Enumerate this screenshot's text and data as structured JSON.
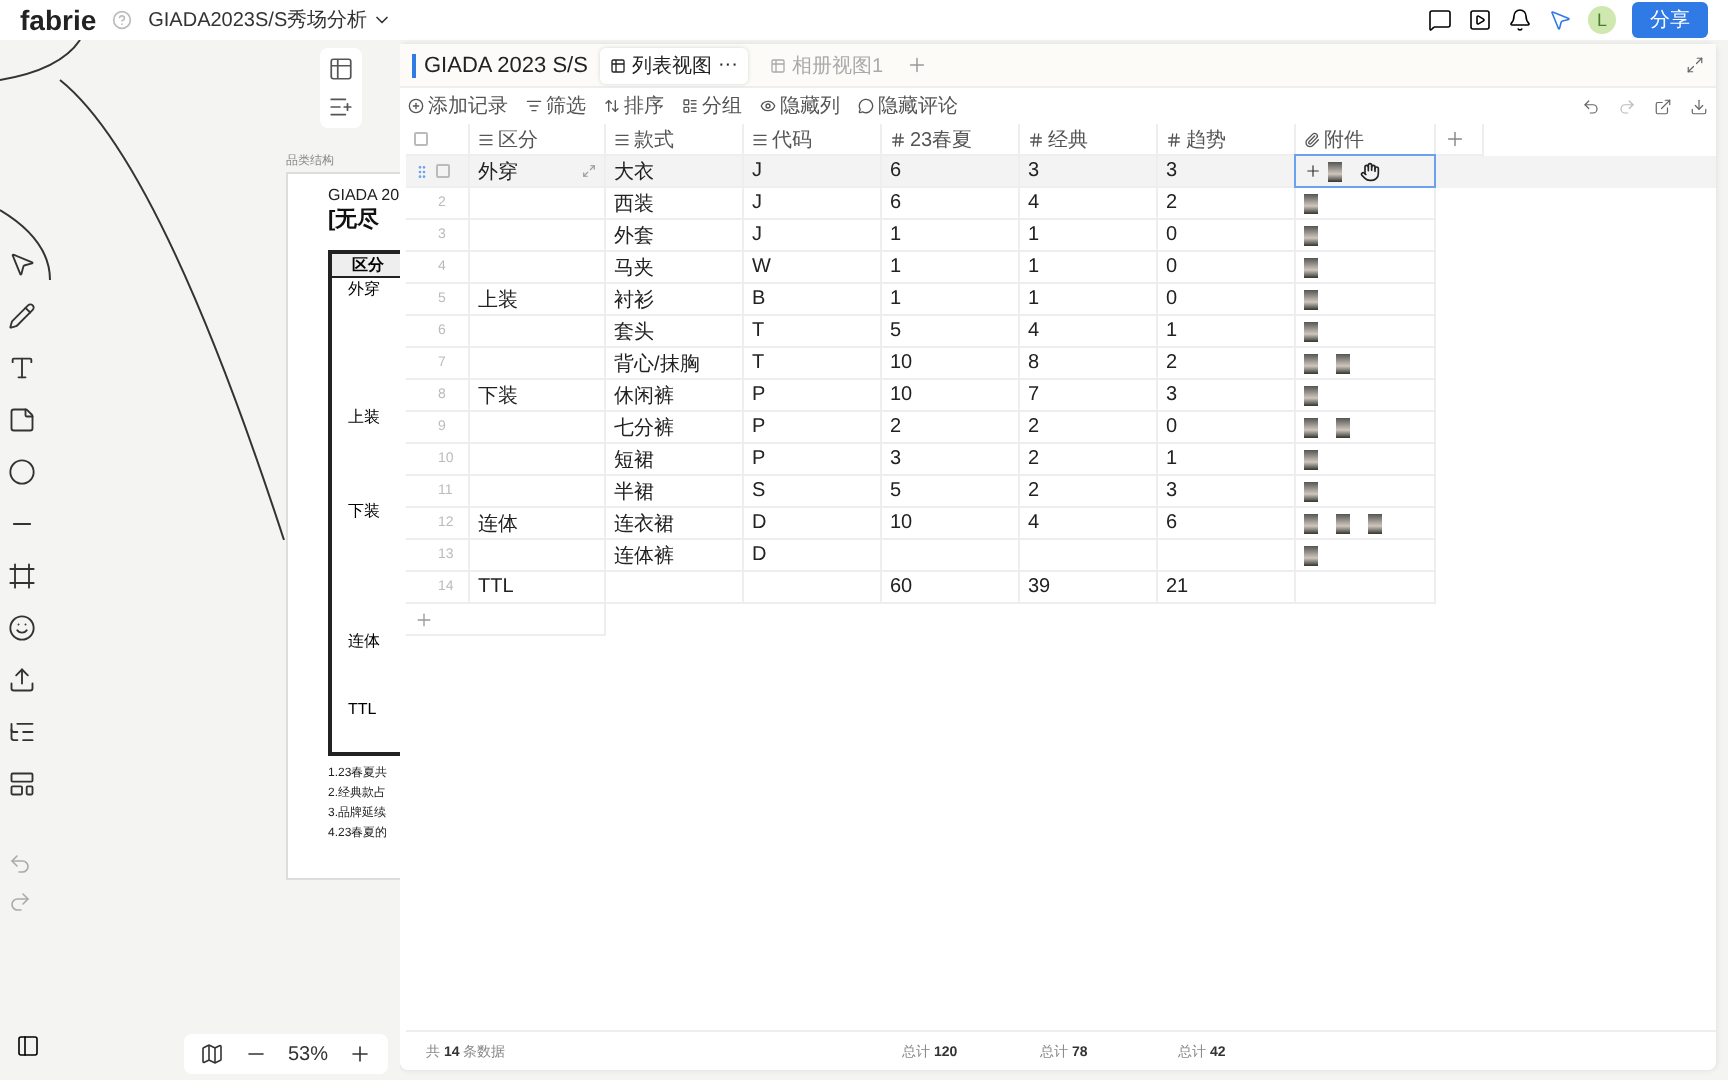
{
  "app": {
    "logo": "fabrie",
    "doc_title": "GIADA2023S/S秀场分析",
    "share": "分享",
    "avatar": "L"
  },
  "canvas": {
    "zoom": "53%",
    "board": {
      "label": "品类结构",
      "title": "GIADA 20",
      "subtitle": "[无尽",
      "table_header": "区分",
      "groups": [
        "外穿",
        "上装",
        "下装",
        "连体",
        "TTL"
      ],
      "notes": [
        "1.23春夏共",
        "2.经典款占",
        "3.品牌延续",
        "4.23春夏的"
      ]
    }
  },
  "sheet": {
    "title": "GIADA 2023 S/S",
    "views": [
      {
        "label": "列表视图",
        "selected": true,
        "more": "···"
      },
      {
        "label": "相册视图1",
        "selected": false
      }
    ],
    "header_checkbox": {
      "checked": false
    },
    "tools": [
      "添加记录",
      "筛选",
      "排序",
      "分组",
      "隐藏列",
      "隐藏评论"
    ],
    "columns": [
      {
        "name": "区分",
        "kind": "text"
      },
      {
        "name": "款式",
        "kind": "text"
      },
      {
        "name": "代码",
        "kind": "text"
      },
      {
        "name": "23春夏",
        "kind": "number"
      },
      {
        "name": "经典",
        "kind": "number"
      },
      {
        "name": "趋势",
        "kind": "number"
      },
      {
        "name": "附件",
        "kind": "attachment"
      }
    ],
    "rows": [
      {
        "selected": true,
        "checked": false,
        "cells": [
          "外穿",
          "大衣",
          "J",
          "6",
          "3",
          "3"
        ],
        "attachments": [
          {
            "kind": "image"
          }
        ]
      },
      {
        "index": "2",
        "selected": false,
        "cells": [
          null,
          "西装",
          "J",
          "6",
          "4",
          "2"
        ],
        "attachments": [
          {
            "kind": "image"
          }
        ]
      },
      {
        "index": "3",
        "selected": false,
        "cells": [
          null,
          "外套",
          "J",
          "1",
          "1",
          "0"
        ],
        "attachments": [
          {
            "kind": "image"
          }
        ]
      },
      {
        "index": "4",
        "selected": false,
        "cells": [
          null,
          "马夹",
          "W",
          "1",
          "1",
          "0"
        ],
        "attachments": [
          {
            "kind": "image"
          }
        ]
      },
      {
        "index": "5",
        "selected": false,
        "cells": [
          "上装",
          "衬衫",
          "B",
          "1",
          "1",
          "0"
        ],
        "attachments": [
          {
            "kind": "image"
          }
        ]
      },
      {
        "index": "6",
        "selected": false,
        "cells": [
          null,
          "套头",
          "T",
          "5",
          "4",
          "1"
        ],
        "attachments": [
          {
            "kind": "image"
          }
        ]
      },
      {
        "index": "7",
        "selected": false,
        "cells": [
          null,
          "背心/抹胸",
          "T",
          "10",
          "8",
          "2"
        ],
        "attachments": [
          {
            "kind": "image"
          },
          {
            "kind": "image"
          }
        ]
      },
      {
        "index": "8",
        "selected": false,
        "cells": [
          "下装",
          "休闲裤",
          "P",
          "10",
          "7",
          "3"
        ],
        "attachments": [
          {
            "kind": "image"
          }
        ]
      },
      {
        "index": "9",
        "selected": false,
        "cells": [
          null,
          "七分裤",
          "P",
          "2",
          "2",
          "0"
        ],
        "attachments": [
          {
            "kind": "image"
          },
          {
            "kind": "image"
          }
        ]
      },
      {
        "index": "10",
        "selected": false,
        "cells": [
          null,
          "短裙",
          "P",
          "3",
          "2",
          "1"
        ],
        "attachments": [
          {
            "kind": "image"
          }
        ]
      },
      {
        "index": "11",
        "selected": false,
        "cells": [
          null,
          "半裙",
          "S",
          "5",
          "2",
          "3"
        ],
        "attachments": [
          {
            "kind": "image"
          }
        ]
      },
      {
        "index": "12",
        "selected": false,
        "cells": [
          "连体",
          "连衣裙",
          "D",
          "10",
          "4",
          "6"
        ],
        "attachments": [
          {
            "kind": "image"
          },
          {
            "kind": "image"
          },
          {
            "kind": "image"
          }
        ]
      },
      {
        "index": "13",
        "selected": false,
        "cells": [
          null,
          "连体裤",
          "D",
          null,
          null,
          null
        ],
        "attachments": [
          {
            "kind": "image"
          }
        ]
      },
      {
        "index": "14",
        "selected": false,
        "cells": [
          "TTL",
          null,
          null,
          "60",
          "39",
          "21"
        ],
        "attachments": []
      }
    ],
    "footer": {
      "count": "共 **14** 条数据",
      "totals": [
        {
          "label": "总计",
          "value": "120"
        },
        {
          "label": "总计",
          "value": "78"
        },
        {
          "label": "总计",
          "value": "42"
        }
      ]
    }
  }
}
